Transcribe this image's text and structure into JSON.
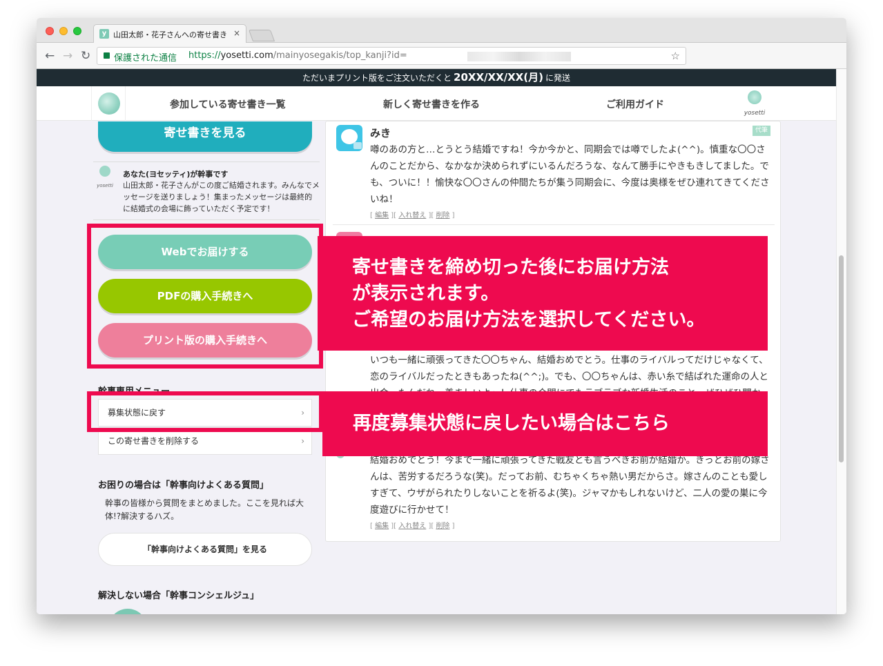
{
  "browser": {
    "tab_title": "山田太郎・花子さんへの寄せ書き",
    "tab_favicon": "y",
    "tab_close": "×",
    "secure_label": "保護された通信",
    "url_scheme": "https://",
    "url_host": "yosetti.com",
    "url_path": "/mainyosegakis/top_kanji?id=",
    "back": "←",
    "forward": "→",
    "reload": "↻",
    "star": "☆"
  },
  "announce": {
    "prefix": "ただいまプリント版をご注文いただくと",
    "date": "20XX/XX/XX(月)",
    "suffix": "に発送"
  },
  "header": {
    "nav": [
      "参加している寄せ書き一覧",
      "新しく寄せ書きを作る",
      "ご利用ガイド"
    ],
    "brand": "yosetti"
  },
  "sidebar": {
    "view_button": "寄せ書きを見る",
    "notice_logo": "yosetti",
    "notice_title": "あなた(ヨセッティ)が幹事です",
    "notice_body": "山田太郎・花子さんがこの度ご結婚されます。みんなでメッセージを送りましょう！集まったメッセージは最終的に結婚式の会場に飾っていただく予定です！",
    "deliver": {
      "web": "Webでお届けする",
      "pdf": "PDFの購入手続きへ",
      "print": "プリント版の購入手続きへ"
    },
    "menu_title": "幹事専用メニュー",
    "menu_items": [
      "募集状態に戻す",
      "この寄せ書きを削除する"
    ],
    "chevron": "›",
    "faq_title": "お困りの場合は「幹事向けよくある質問」",
    "faq_text": "幹事の皆様から質問をまとめました。ここを見れば大体!?解決するハズ。",
    "faq_button": "「幹事向けよくある質問」を見る",
    "concierge_title": "解決しない場合「幹事コンシェルジュ」"
  },
  "messages": [
    {
      "name": "みき",
      "badge": "代筆",
      "body": "噂のあの方と…とうとう結婚ですね！今か今かと、同期会では噂でしたよ(^^)。慎重な〇〇さんのことだから、なかなか決められずにいるんだろうな、なんて勝手にやきもきしてました。でも、ついに！！愉快な〇〇さんの仲間たちが集う同期会に、今度は奥様をぜひ連れてきてくださいね！"
    },
    {
      "name": "",
      "badge": "",
      "body": "いつも一緒に頑張ってきた〇〇ちゃん、結婚おめでとう。仕事のライバルってだけじゃなくて、恋のライバルだったときもあったね(^^;)。でも、〇〇ちゃんは、赤い糸で結ばれた運命の人と出会ったんだね。羨ましいよ〜！仕事の合間にでもラブラブな新婚生活のこと、ぜひぜひ聞か"
    },
    {
      "name": "",
      "badge": "",
      "body": "結婚おめでとう！今まで一緒に頑張ってきた戦友とも言うべきお前が結婚か。きっとお前の嫁さんは、苦労するだろうな(笑)。だってお前、むちゃくちゃ熱い男だからさ。嫁さんのことも愛しすぎて、ウザがられたりしないことを祈るよ(笑)。ジャマかもしれないけど、二人の愛の巣に今度遊びに行かせて！"
    }
  ],
  "msg_links": {
    "edit": "編集",
    "swap": "入れ替え",
    "delete": "削除"
  },
  "callouts": {
    "top": [
      "寄せ書きを締め切った後にお届け方法",
      "が表示されます。",
      "ご希望のお届け方法を選択してください。"
    ],
    "bottom": "再度募集状態に戻したい場合はこちら"
  },
  "colors": {
    "accent": "#ee0a4f",
    "teal": "#20aebd",
    "mint": "#78cdb6",
    "green": "#97c700",
    "pink": "#ee7f9b"
  }
}
